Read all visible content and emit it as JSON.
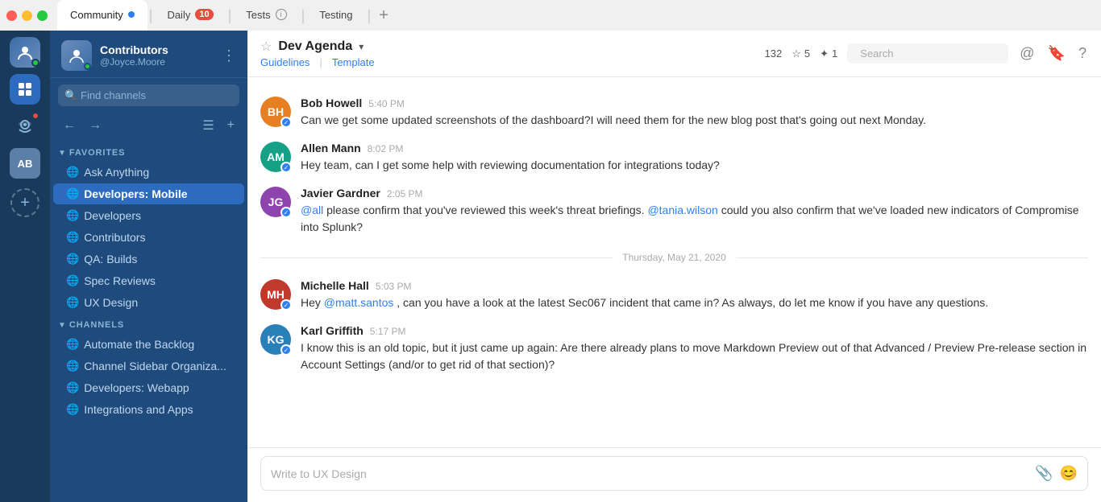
{
  "titlebar": {
    "tabs": [
      {
        "id": "community",
        "label": "Community",
        "active": true,
        "dot": true,
        "badge": null,
        "info": false
      },
      {
        "id": "daily",
        "label": "Daily",
        "active": false,
        "dot": false,
        "badge": "10",
        "info": false
      },
      {
        "id": "tests",
        "label": "Tests",
        "active": false,
        "dot": false,
        "badge": null,
        "info": true
      },
      {
        "id": "testing",
        "label": "Testing",
        "active": false,
        "dot": false,
        "badge": null,
        "info": false
      }
    ],
    "add_tab_label": "+"
  },
  "sidebar": {
    "workspace_name": "Contributors",
    "username": "@Joyce.Moore",
    "search_placeholder": "Find channels",
    "sections": {
      "favorites": {
        "label": "FAVORITES",
        "items": [
          {
            "id": "ask-anything",
            "label": "Ask Anything",
            "active": false
          },
          {
            "id": "developers-mobile",
            "label": "Developers: Mobile",
            "active": true
          },
          {
            "id": "developers",
            "label": "Developers",
            "active": false
          },
          {
            "id": "contributors",
            "label": "Contributors",
            "active": false
          },
          {
            "id": "qa-builds",
            "label": "QA: Builds",
            "active": false
          },
          {
            "id": "spec-reviews",
            "label": "Spec Reviews",
            "active": false
          },
          {
            "id": "ux-design",
            "label": "UX Design",
            "active": false
          }
        ]
      },
      "channels": {
        "label": "CHANNELS",
        "items": [
          {
            "id": "automate-backlog",
            "label": "Automate the Backlog",
            "active": false
          },
          {
            "id": "channel-sidebar",
            "label": "Channel Sidebar Organiza...",
            "active": false
          },
          {
            "id": "developers-webapp",
            "label": "Developers: Webapp",
            "active": false
          },
          {
            "id": "integrations-apps",
            "label": "Integrations and Apps",
            "active": false
          }
        ]
      }
    }
  },
  "chat": {
    "channel_name": "Dev Agenda",
    "links": [
      {
        "id": "guidelines",
        "label": "Guidelines"
      },
      {
        "id": "template",
        "label": "Template"
      }
    ],
    "stats": {
      "count": "132",
      "reactions": "5",
      "pins": "1"
    },
    "search_placeholder": "Search",
    "messages": [
      {
        "id": "msg1",
        "author": "Bob Howell",
        "time": "5:40 PM",
        "avatar_bg": "#e67e22",
        "initials": "BH",
        "verified": true,
        "text": "Can we get some updated screenshots of the dashboard?I will need them for the new blog post that's going out next Monday.",
        "mentions": []
      },
      {
        "id": "msg2",
        "author": "Allen Mann",
        "time": "8:02 PM",
        "avatar_bg": "#16a085",
        "initials": "AM",
        "verified": true,
        "text": "Hey team, can I get some help with reviewing documentation for integrations today?",
        "mentions": []
      },
      {
        "id": "msg3",
        "author": "Javier Gardner",
        "time": "2:05 PM",
        "avatar_bg": "#8e44ad",
        "initials": "JG",
        "verified": true,
        "text_parts": [
          {
            "type": "mention",
            "text": "@all"
          },
          {
            "type": "plain",
            "text": " please confirm that you've reviewed this week's threat briefings. "
          },
          {
            "type": "mention",
            "text": "@tania.wilson"
          },
          {
            "type": "plain",
            "text": " could you also confirm that we've loaded new indicators of Compromise into Splunk?"
          }
        ]
      }
    ],
    "date_divider": "Thursday, May 21, 2020",
    "messages_after_divider": [
      {
        "id": "msg4",
        "author": "Michelle Hall",
        "time": "5:03 PM",
        "avatar_bg": "#c0392b",
        "initials": "MH",
        "verified": true,
        "text_parts": [
          {
            "type": "plain",
            "text": "Hey "
          },
          {
            "type": "mention",
            "text": "@matt.santos"
          },
          {
            "type": "plain",
            "text": ", can you have a look at the latest Sec067 incident that came in? As always, do let me know if you have any questions."
          }
        ]
      },
      {
        "id": "msg5",
        "author": "Karl Griffith",
        "time": "5:17 PM",
        "avatar_bg": "#2980b9",
        "initials": "KG",
        "verified": true,
        "text": "I know this is an old topic, but it just came up again: Are there already plans to move Markdown Preview out of that Advanced / Preview Pre-release section in Account Settings (and/or to get rid of that section)?"
      }
    ],
    "input_placeholder": "Write to UX Design"
  }
}
